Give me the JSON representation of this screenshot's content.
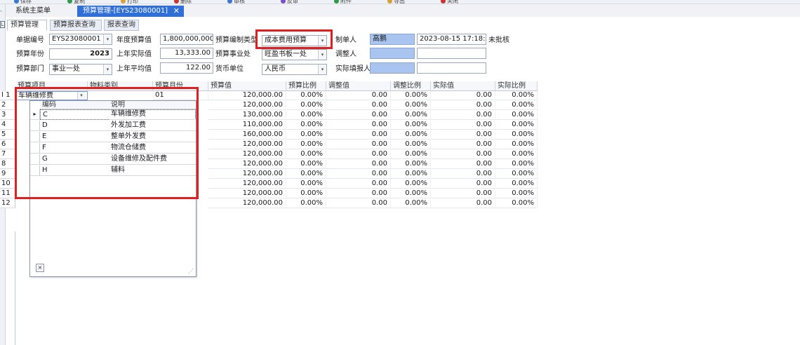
{
  "toolbar": {
    "items": [
      "保存",
      "复制",
      "打印",
      "删除",
      "审核",
      "反审",
      "附件",
      "导出",
      "关闭"
    ]
  },
  "left_strip": {
    "pin": "𝅐",
    "panel": "L"
  },
  "doc_tabs": {
    "main": "系统主菜单",
    "budget": "预算管理-[EYS23080001]",
    "close": "✕"
  },
  "sub_tabs": [
    "预算管理",
    "预算报表查询",
    "报表查询"
  ],
  "form": {
    "doc_no_label": "单据编号",
    "doc_no": "EYS23080001",
    "year_budget_label": "年度预算值",
    "year_budget": "1,800,000,000.0",
    "compile_type_label": "预算编制类型",
    "compile_type": "成本费用预算",
    "creator_label": "制单人",
    "creator": "高鹏",
    "created_time": "2023-08-15 17:18:26",
    "status": "未批核",
    "year_label": "预算年份",
    "year": "2023",
    "last_actual_label": "上年实际值",
    "last_actual": "13,333.00",
    "business_label": "预算事业处",
    "business": "旺盈书板一处",
    "adjuster_label": "调整人",
    "dept_label": "预算部门",
    "dept": "事业一处",
    "last_avg_label": "上年平均值",
    "last_avg": "122.00",
    "currency_label": "货币单位",
    "currency": "人民币",
    "actual_filler_label": "实际填报人"
  },
  "grid": {
    "headers": [
      "预算项目",
      "物料类别",
      "预算月份",
      "预算值",
      "预算比例",
      "调整值",
      "调整比例",
      "实际值",
      "实际比例"
    ],
    "editing_item": "车辆维修费",
    "editing_month": "01",
    "rows": [
      {
        "n": "1",
        "budget": "120,000.00",
        "ratio": "0.00%",
        "adj": "0.00",
        "adj_ratio": "0.00%",
        "actual": "0.00",
        "act_ratio": "0.00%"
      },
      {
        "n": "2",
        "budget": "120,000.00",
        "ratio": "0.00%",
        "adj": "0.00",
        "adj_ratio": "0.00%",
        "actual": "0.00",
        "act_ratio": "0.00%"
      },
      {
        "n": "3",
        "budget": "130,000.00",
        "ratio": "0.00%",
        "adj": "0.00",
        "adj_ratio": "0.00%",
        "actual": "0.00",
        "act_ratio": "0.00%"
      },
      {
        "n": "4",
        "budget": "110,000.00",
        "ratio": "0.00%",
        "adj": "0.00",
        "adj_ratio": "0.00%",
        "actual": "0.00",
        "act_ratio": "0.00%"
      },
      {
        "n": "5",
        "budget": "160,000.00",
        "ratio": "0.00%",
        "adj": "0.00",
        "adj_ratio": "0.00%",
        "actual": "0.00",
        "act_ratio": "0.00%"
      },
      {
        "n": "6",
        "budget": "120,000.00",
        "ratio": "0.00%",
        "adj": "0.00",
        "adj_ratio": "0.00%",
        "actual": "0.00",
        "act_ratio": "0.00%"
      },
      {
        "n": "7",
        "budget": "120,000.00",
        "ratio": "0.00%",
        "adj": "0.00",
        "adj_ratio": "0.00%",
        "actual": "0.00",
        "act_ratio": "0.00%"
      },
      {
        "n": "8",
        "budget": "120,000.00",
        "ratio": "0.00%",
        "adj": "0.00",
        "adj_ratio": "0.00%",
        "actual": "0.00",
        "act_ratio": "0.00%"
      },
      {
        "n": "9",
        "budget": "120,000.00",
        "ratio": "0.00%",
        "adj": "0.00",
        "adj_ratio": "0.00%",
        "actual": "0.00",
        "act_ratio": "0.00%"
      },
      {
        "n": "10",
        "budget": "120,000.00",
        "ratio": "0.00%",
        "adj": "0.00",
        "adj_ratio": "0.00%",
        "actual": "0.00",
        "act_ratio": "0.00%"
      },
      {
        "n": "11",
        "budget": "120,000.00",
        "ratio": "0.00%",
        "adj": "0.00",
        "adj_ratio": "0.00%",
        "actual": "0.00",
        "act_ratio": "0.00%"
      },
      {
        "n": "12",
        "budget": "120,000.00",
        "ratio": "0.00%",
        "adj": "0.00",
        "adj_ratio": "0.00%",
        "actual": "0.00",
        "act_ratio": "0.00%"
      }
    ]
  },
  "popup": {
    "headers": [
      "编码",
      "说明"
    ],
    "rows": [
      {
        "code": "C",
        "desc": "车辆维修费"
      },
      {
        "code": "D",
        "desc": "外发加工费"
      },
      {
        "code": "E",
        "desc": "整单外发费"
      },
      {
        "code": "F",
        "desc": "物流仓储费"
      },
      {
        "code": "G",
        "desc": "设备维修及配件费"
      },
      {
        "code": "H",
        "desc": "辅料"
      }
    ],
    "close": "×",
    "grip": "⋰"
  },
  "colors": {
    "accent": "#2f6fd6",
    "highlight": "#e02020",
    "readonly_field": "#a9c4ee"
  }
}
